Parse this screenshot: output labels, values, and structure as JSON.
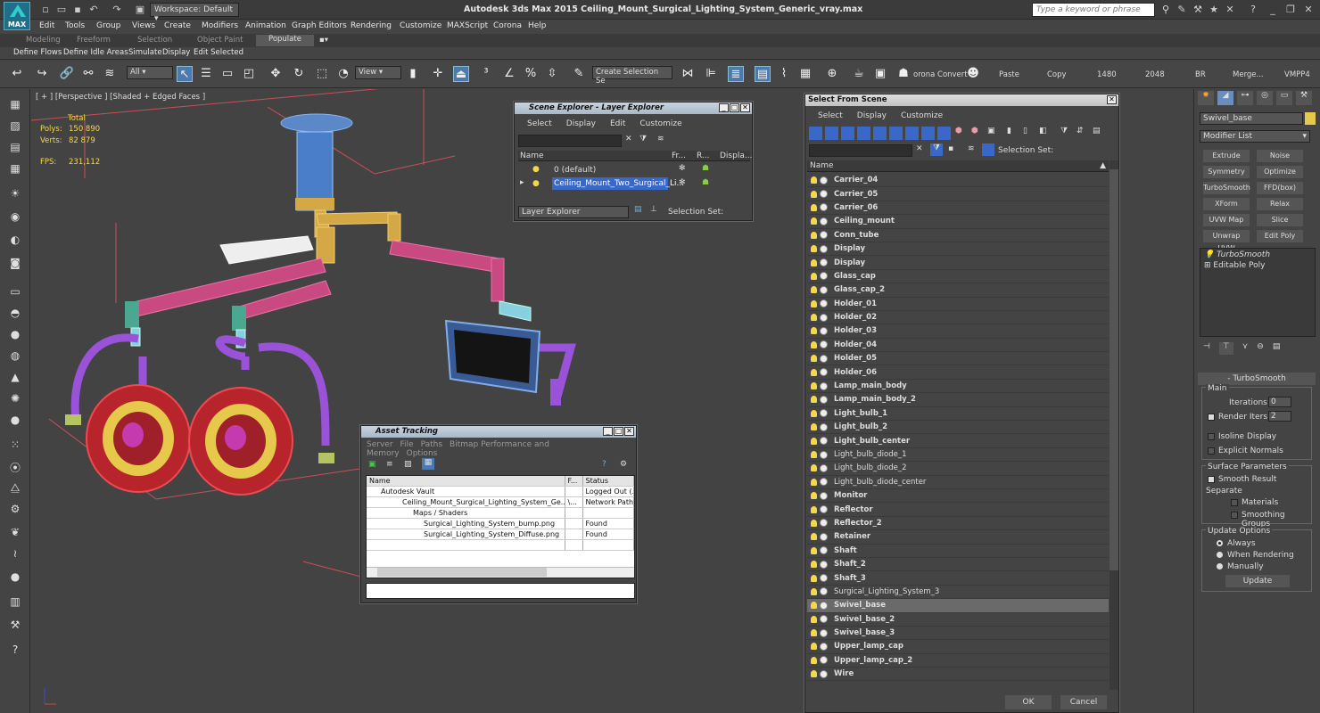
{
  "titlebar": {
    "workspace": "Workspace: Default",
    "title": "Autodesk 3ds Max  2015     Ceiling_Mount_Surgical_Lighting_System_Generic_vray.max",
    "search_placeholder": "Type a keyword or phrase",
    "logo": "MAX"
  },
  "menus": [
    "Edit",
    "Tools",
    "Group",
    "Views",
    "Create",
    "Modifiers",
    "Animation",
    "Graph Editors",
    "Rendering",
    "Customize",
    "MAXScript",
    "Corona",
    "Help"
  ],
  "ribbon_tabs": [
    "Modeling",
    "Freeform",
    "Selection",
    "Object Paint",
    "Populate"
  ],
  "sub_buttons": [
    "Define Flows",
    "Define Idle Areas",
    "Simulate",
    "Display",
    "Edit Selected"
  ],
  "toolbar": {
    "filter": "All",
    "view": "View",
    "selection_set": "Create Selection Se",
    "corona": "orona Convert",
    "paste": "Paste",
    "copy": "Copy",
    "w": "1480",
    "h": "2048",
    "br": "BR",
    "merge": "Merge...",
    "vmpp": "VMPP4"
  },
  "viewport": {
    "label": "[ + ] [Perspective ] [Shaded + Edged Faces ]",
    "total": "Total",
    "polys_label": "Polys:",
    "polys": "150 890",
    "verts_label": "Verts:",
    "verts": "82 879",
    "fps_label": "FPS:",
    "fps": "231,112"
  },
  "scene_explorer": {
    "title": "Scene Explorer - Layer Explorer",
    "menu": [
      "Select",
      "Display",
      "Edit",
      "Customize"
    ],
    "cols": [
      "Name",
      "Fr...",
      "R...",
      "Displa..."
    ],
    "rows": [
      "0 (default)",
      "Ceiling_Mount_Two_Surgical_Li..."
    ],
    "footer_left": "Layer Explorer",
    "footer_right": "Selection Set:"
  },
  "asset_tracking": {
    "title": "Asset Tracking",
    "menu": [
      "Server",
      "File",
      "Paths",
      "Bitmap Performance and Memory",
      "Options"
    ],
    "cols": [
      "Name",
      "F...",
      "Status"
    ],
    "rows": [
      [
        "Autodesk Vault",
        "",
        "Logged Out (..."
      ],
      [
        "Ceiling_Mount_Surgical_Lighting_System_Ge...",
        "\\...",
        "Network Path"
      ],
      [
        "Maps / Shaders",
        "",
        ""
      ],
      [
        "Surgical_Lighting_System_bump.png",
        "",
        "Found"
      ],
      [
        "Surgical_Lighting_System_Diffuse.png",
        "",
        "Found"
      ]
    ]
  },
  "select_from_scene": {
    "title": "Select From Scene",
    "menu": [
      "Select",
      "Display",
      "Customize"
    ],
    "selection_set": "Selection Set:",
    "col": "Name",
    "ok": "OK",
    "cancel": "Cancel",
    "items": [
      {
        "n": "Carrier_04",
        "b": 1
      },
      {
        "n": "Carrier_05",
        "b": 1
      },
      {
        "n": "Carrier_06",
        "b": 1
      },
      {
        "n": "Ceiling_mount",
        "b": 1
      },
      {
        "n": "Conn_tube",
        "b": 1
      },
      {
        "n": "Display",
        "b": 1
      },
      {
        "n": "Display",
        "b": 1
      },
      {
        "n": "Glass_cap",
        "b": 1
      },
      {
        "n": "Glass_cap_2",
        "b": 1
      },
      {
        "n": "Holder_01",
        "b": 1
      },
      {
        "n": "Holder_02",
        "b": 1
      },
      {
        "n": "Holder_03",
        "b": 1
      },
      {
        "n": "Holder_04",
        "b": 1
      },
      {
        "n": "Holder_05",
        "b": 1
      },
      {
        "n": "Holder_06",
        "b": 1
      },
      {
        "n": "Lamp_main_body",
        "b": 1
      },
      {
        "n": "Lamp_main_body_2",
        "b": 1
      },
      {
        "n": "Light_bulb_1",
        "b": 1
      },
      {
        "n": "Light_bulb_2",
        "b": 1
      },
      {
        "n": "Light_bulb_center",
        "b": 1
      },
      {
        "n": "Light_bulb_diode_1",
        "b": 0
      },
      {
        "n": "Light_bulb_diode_2",
        "b": 0
      },
      {
        "n": "Light_bulb_diode_center",
        "b": 0
      },
      {
        "n": "Monitor",
        "b": 1
      },
      {
        "n": "Reflector",
        "b": 1
      },
      {
        "n": "Reflector_2",
        "b": 1
      },
      {
        "n": "Retainer",
        "b": 1
      },
      {
        "n": "Shaft",
        "b": 1
      },
      {
        "n": "Shaft_2",
        "b": 1
      },
      {
        "n": "Shaft_3",
        "b": 1
      },
      {
        "n": "Surgical_Lighting_System_3",
        "b": 0
      },
      {
        "n": "Swivel_base",
        "b": 1,
        "sel": 1
      },
      {
        "n": "Swivel_base_2",
        "b": 1
      },
      {
        "n": "Swivel_base_3",
        "b": 1
      },
      {
        "n": "Upper_lamp_cap",
        "b": 1
      },
      {
        "n": "Upper_lamp_cap_2",
        "b": 1
      },
      {
        "n": "Wire",
        "b": 1
      }
    ]
  },
  "command_panel": {
    "object_name": "Swivel_base",
    "modifier_list": "Modifier List",
    "buttons": [
      "Extrude",
      "Noise",
      "Symmetry",
      "Optimize",
      "TurboSmooth",
      "FFD(box)",
      "XForm",
      "Relax",
      "UVW Map",
      "Slice",
      "Unwrap UVW",
      "Edit Poly"
    ],
    "stack": [
      "TurboSmooth",
      "Editable Poly"
    ],
    "rollout": "TurboSmooth",
    "main": "Main",
    "iterations_label": "Iterations:",
    "iterations": "0",
    "render_iters_label": "Render Iters:",
    "render_iters": "2",
    "isoline": "Isoline Display",
    "explicit": "Explicit Normals",
    "surface_params": "Surface Parameters",
    "smooth_result": "Smooth Result",
    "separate": "Separate",
    "materials": "Materials",
    "smoothing_groups": "Smoothing Groups",
    "update_options": "Update Options",
    "always": "Always",
    "when_rendering": "When Rendering",
    "manually": "Manually",
    "update": "Update"
  },
  "colors": {
    "bg": "#444444",
    "selected_row": "#6a6a6a",
    "stats": "#f5d84a"
  }
}
